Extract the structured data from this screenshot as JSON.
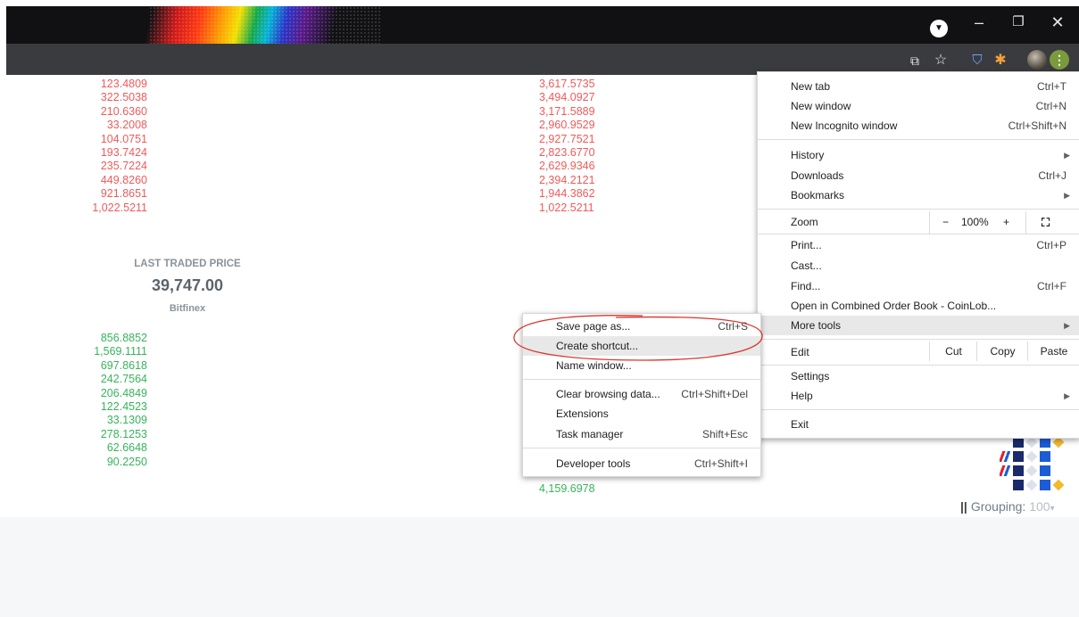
{
  "window": {
    "minimize_glyph": "–",
    "restore_glyph": "❐",
    "close_glyph": "✕",
    "profile_glyph": "▼"
  },
  "toolbar": {
    "icons": [
      "share-icon",
      "star-icon",
      "bitwarden-icon",
      "extensions-icon",
      "profile-avatar",
      "menu-kebab-icon"
    ],
    "share_glyph": "⧉",
    "star_glyph": "☆",
    "shield_glyph": "⛉",
    "puzzle_glyph": "✱",
    "kebab_glyph": "⋮"
  },
  "orderbook": {
    "asks_amounts": [
      "123.4809",
      "322.5038",
      "210.6360",
      "33.2008",
      "104.0751",
      "193.7424",
      "235.7224",
      "449.8260",
      "921.8651",
      "1,022.5211"
    ],
    "asks_totals": [
      "3,617.5735",
      "3,494.0927",
      "3,171.5889",
      "2,960.9529",
      "2,927.7521",
      "2,823.6770",
      "2,629.9346",
      "2,394.2121",
      "1,944.3862",
      "1,022.5211"
    ],
    "last_traded_label": "LAST TRADED PRICE",
    "last_traded_price": "39,747.00",
    "last_traded_exchange": "Bitfinex",
    "bids_amounts": [
      "856.8852",
      "1,569.1111",
      "697.8618",
      "242.7564",
      "206.4849",
      "122.4523",
      "33.1309",
      "278.1253",
      "62.6648",
      "90.2250"
    ],
    "bids_total_last": "4,159.6978",
    "grouping_label": "Grouping:",
    "grouping_value": "100",
    "grouping_caret": "▾",
    "grouping_bars": "||"
  },
  "chrome_menu": {
    "new_tab": "New tab",
    "new_tab_sc": "Ctrl+T",
    "new_window": "New window",
    "new_window_sc": "Ctrl+N",
    "new_incognito": "New Incognito window",
    "new_incognito_sc": "Ctrl+Shift+N",
    "history": "History",
    "downloads": "Downloads",
    "downloads_sc": "Ctrl+J",
    "bookmarks": "Bookmarks",
    "zoom": "Zoom",
    "zoom_minus": "−",
    "zoom_value": "100%",
    "zoom_plus": "+",
    "print": "Print...",
    "print_sc": "Ctrl+P",
    "cast": "Cast...",
    "find": "Find...",
    "find_sc": "Ctrl+F",
    "open_in": "Open in Combined Order Book - CoinLob...",
    "more_tools": "More tools",
    "edit": "Edit",
    "cut": "Cut",
    "copy": "Copy",
    "paste": "Paste",
    "settings": "Settings",
    "help": "Help",
    "exit": "Exit",
    "arrow": "▶"
  },
  "more_tools_menu": {
    "save_page": "Save page as...",
    "save_page_sc": "Ctrl+S",
    "create_shortcut": "Create shortcut...",
    "name_window": "Name window...",
    "clear_data": "Clear browsing data...",
    "clear_data_sc": "Ctrl+Shift+Del",
    "extensions": "Extensions",
    "task_manager": "Task manager",
    "task_manager_sc": "Shift+Esc",
    "dev_tools": "Developer tools",
    "dev_tools_sc": "Ctrl+Shift+I"
  },
  "colors": {
    "ask_red": "#ef5a5a",
    "bid_green": "#36b45a",
    "annotation_red": "#d9352b",
    "toolbar_gray": "#3a3b3e"
  }
}
